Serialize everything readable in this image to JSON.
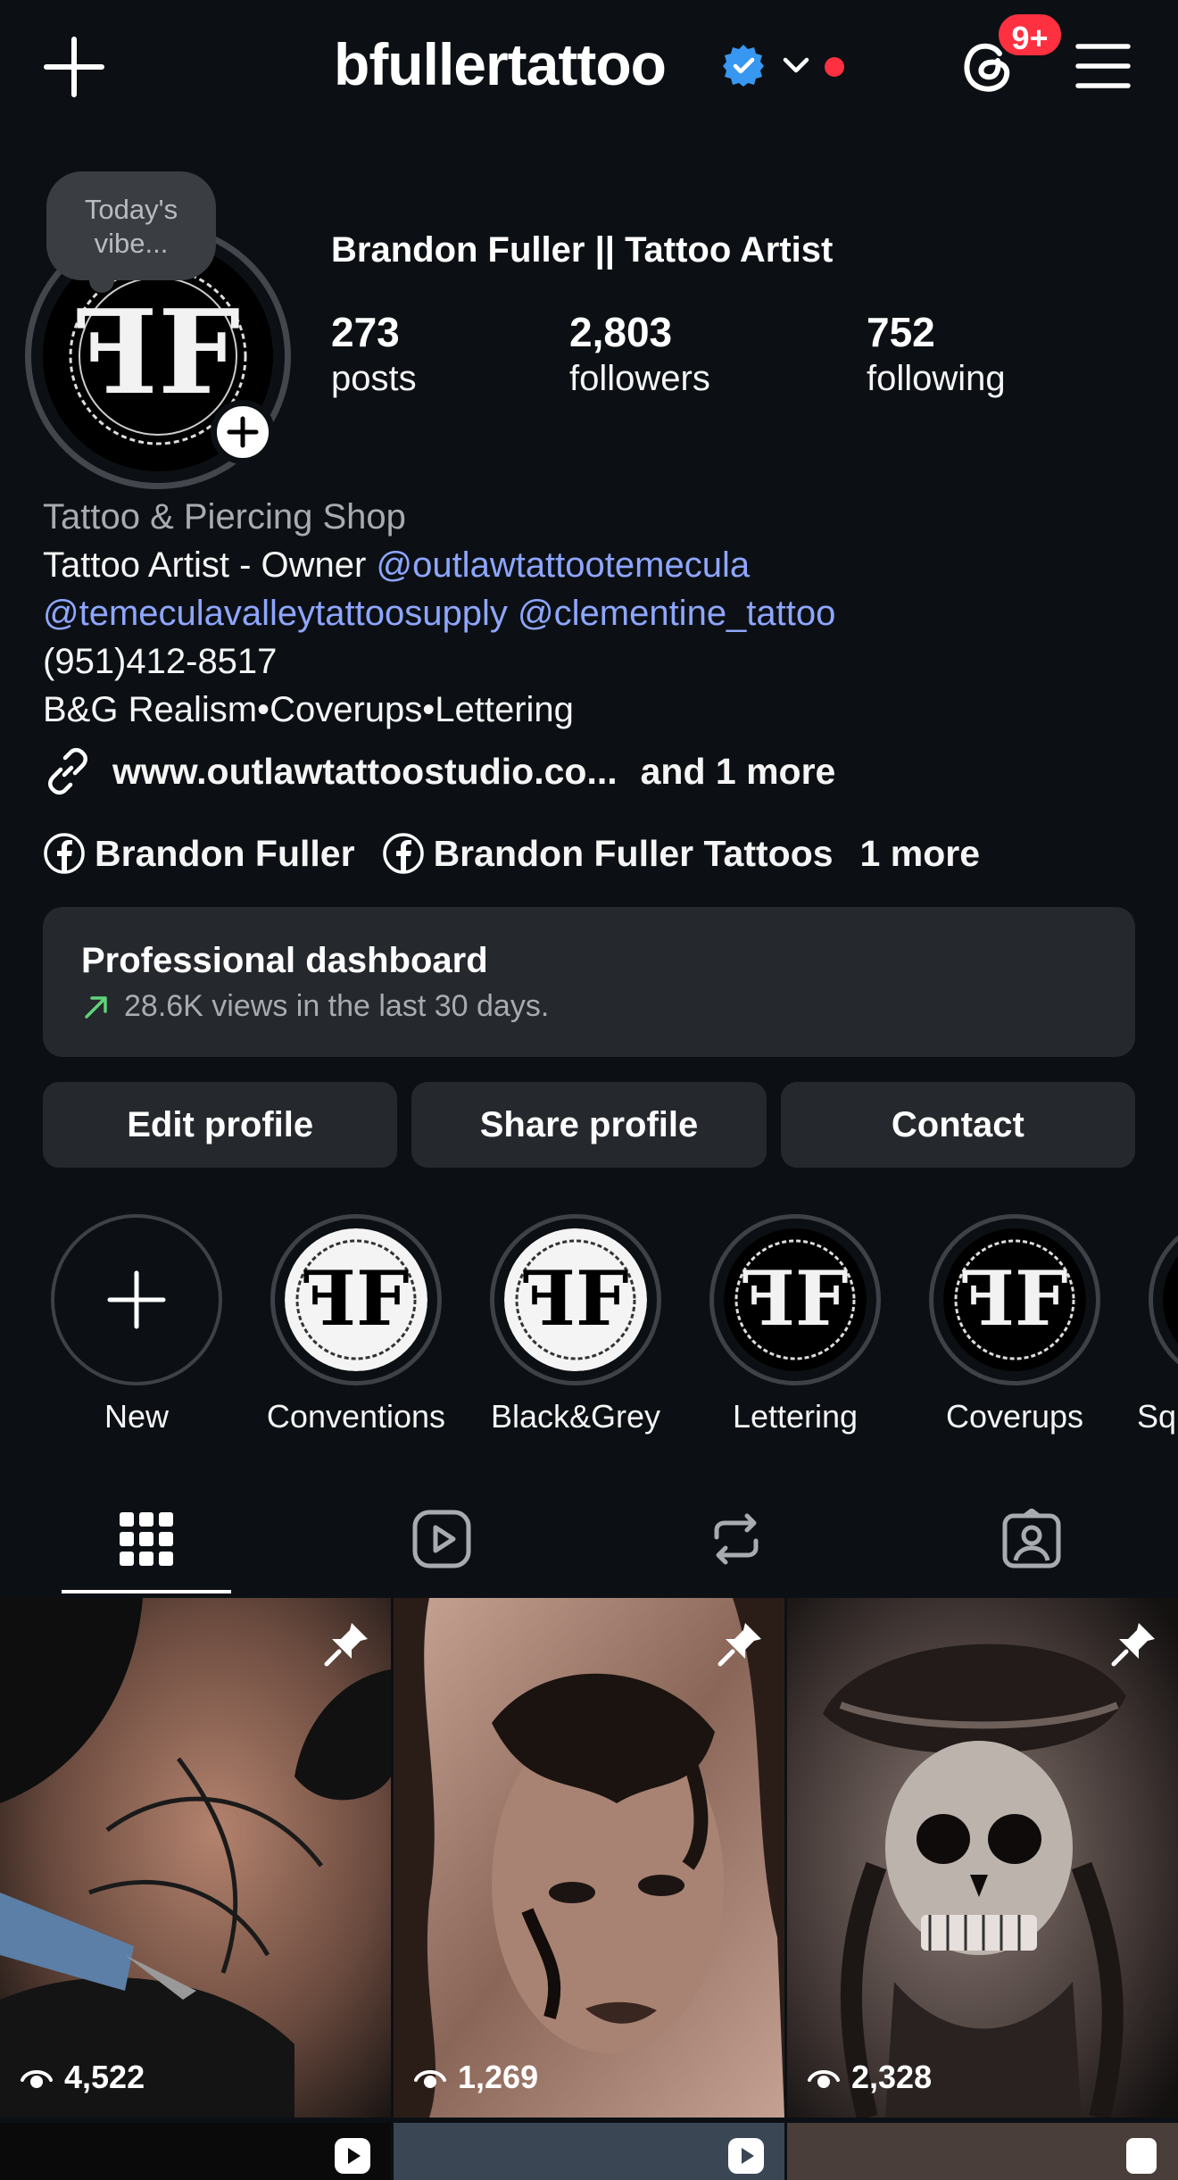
{
  "header": {
    "username": "bfullertattoo",
    "threads_badge": "9+"
  },
  "profile": {
    "note": "Today's vibe...",
    "display_name": "Brandon Fuller || Tattoo Artist",
    "stats": [
      {
        "value": "273",
        "label": "posts"
      },
      {
        "value": "2,803",
        "label": "followers"
      },
      {
        "value": "752",
        "label": "following"
      }
    ]
  },
  "bio": {
    "category": "Tattoo & Piercing Shop",
    "line1_prefix": "Tattoo Artist - Owner ",
    "mention1": "@outlawtattootemecula",
    "mention2": "@temeculavalleytattoosupply",
    "mention3": "@clementine_tattoo",
    "phone": "(951)412-8517",
    "styles": "B&G Realism•Coverups•Lettering",
    "link": "www.outlawtattoostudio.co...",
    "link_more": "and 1 more",
    "fb_links": [
      "Brandon Fuller",
      "Brandon Fuller Tattoos"
    ],
    "fb_more": "1 more"
  },
  "dashboard": {
    "title": "Professional dashboard",
    "subtitle": "28.6K views in the last 30 days."
  },
  "actions": {
    "edit": "Edit profile",
    "share": "Share profile",
    "contact": "Contact"
  },
  "highlights": [
    "New",
    "Conventions",
    "Black&Grey",
    "Lettering",
    "Coverups",
    "Sq"
  ],
  "posts": [
    {
      "views": "4,522",
      "pinned": true
    },
    {
      "views": "1,269",
      "pinned": true
    },
    {
      "views": "2,328",
      "pinned": true
    }
  ],
  "colors": {
    "background": "#0c1014",
    "card": "#25282d",
    "mention": "#8ea6ff",
    "verified": "#3897f0",
    "badge": "#ff3040",
    "trend": "#5fd47a"
  }
}
